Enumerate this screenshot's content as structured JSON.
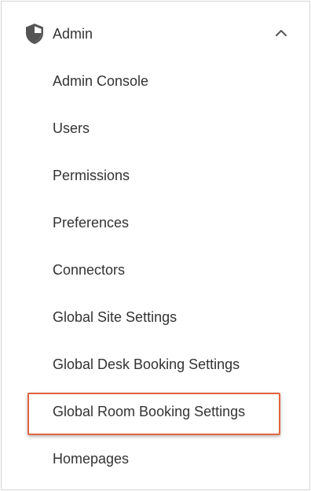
{
  "colors": {
    "highlight_border": "#e0643f",
    "text": "#333333",
    "icon": "#555555",
    "panel_border": "#d6d6d6"
  },
  "section": {
    "title": "Admin",
    "icon": "shield-icon",
    "toggle_icon": "chevron-up-icon",
    "expanded": true
  },
  "menu": {
    "items": [
      {
        "label": "Admin Console"
      },
      {
        "label": "Users"
      },
      {
        "label": "Permissions"
      },
      {
        "label": "Preferences"
      },
      {
        "label": "Connectors"
      },
      {
        "label": "Global Site Settings"
      },
      {
        "label": "Global Desk Booking Settings"
      },
      {
        "label": "Global Room Booking Settings",
        "highlighted": true
      },
      {
        "label": "Homepages"
      }
    ]
  }
}
